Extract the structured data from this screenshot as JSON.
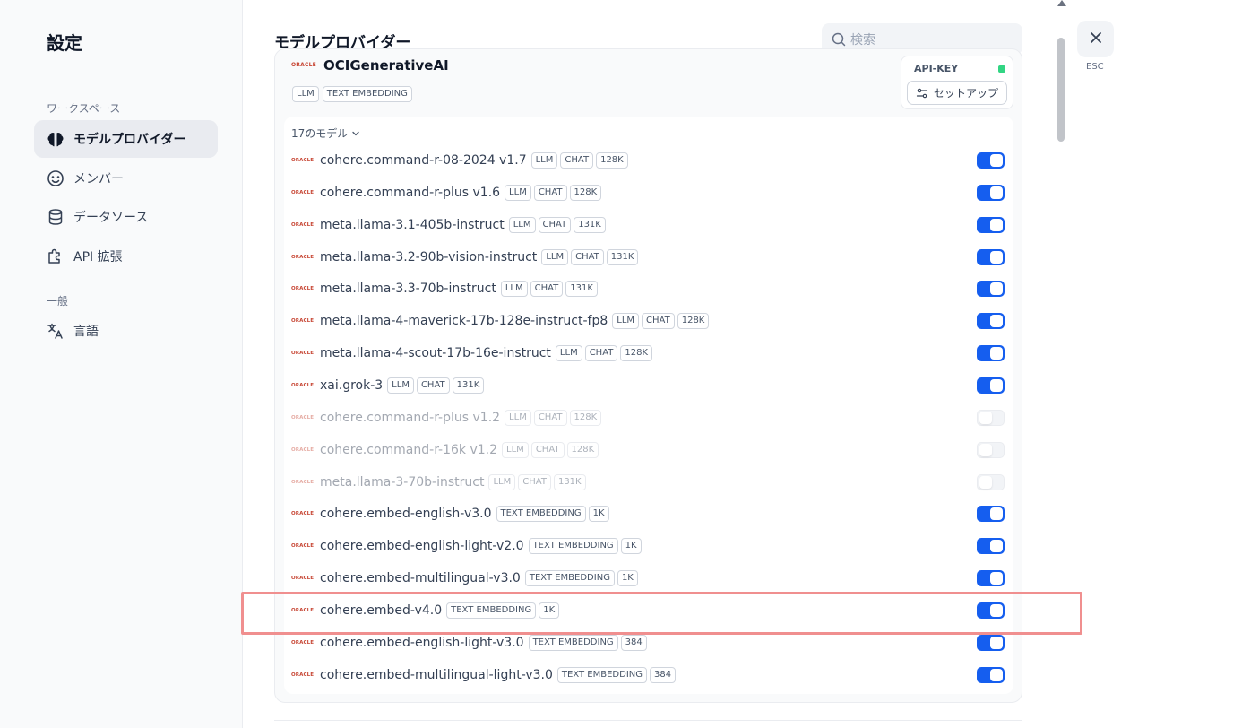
{
  "sidebar": {
    "title": "設定",
    "workspace_label": "ワークスペース",
    "general_label": "一般",
    "items": [
      {
        "label": "モデルプロバイダー"
      },
      {
        "label": "メンバー"
      },
      {
        "label": "データソース"
      },
      {
        "label": "API 拡張"
      },
      {
        "label": "言語"
      }
    ]
  },
  "header": {
    "title": "モデルプロバイダー",
    "search_placeholder": "検索",
    "close_label": "ESC"
  },
  "provider": {
    "logo_text": "ORACLE",
    "name": "OCIGenerativeAI",
    "badges": [
      "LLM",
      "TEXT EMBEDDING"
    ],
    "api_key_label": "API-KEY",
    "api_key_status_color": "#32d583",
    "setup_label": "セットアップ",
    "models_count": "17のモデル"
  },
  "models": [
    {
      "name": "cohere.command-r-08-2024 v1.7",
      "tags": [
        "LLM",
        "CHAT",
        "128K"
      ],
      "enabled": true
    },
    {
      "name": "cohere.command-r-plus v1.6",
      "tags": [
        "LLM",
        "CHAT",
        "128K"
      ],
      "enabled": true
    },
    {
      "name": "meta.llama-3.1-405b-instruct",
      "tags": [
        "LLM",
        "CHAT",
        "131K"
      ],
      "enabled": true
    },
    {
      "name": "meta.llama-3.2-90b-vision-instruct",
      "tags": [
        "LLM",
        "CHAT",
        "131K"
      ],
      "enabled": true
    },
    {
      "name": "meta.llama-3.3-70b-instruct",
      "tags": [
        "LLM",
        "CHAT",
        "131K"
      ],
      "enabled": true
    },
    {
      "name": "meta.llama-4-maverick-17b-128e-instruct-fp8",
      "tags": [
        "LLM",
        "CHAT",
        "128K"
      ],
      "enabled": true
    },
    {
      "name": "meta.llama-4-scout-17b-16e-instruct",
      "tags": [
        "LLM",
        "CHAT",
        "128K"
      ],
      "enabled": true
    },
    {
      "name": "xai.grok-3",
      "tags": [
        "LLM",
        "CHAT",
        "131K"
      ],
      "enabled": true
    },
    {
      "name": "cohere.command-r-plus v1.2",
      "tags": [
        "LLM",
        "CHAT",
        "128K"
      ],
      "enabled": false
    },
    {
      "name": "cohere.command-r-16k v1.2",
      "tags": [
        "LLM",
        "CHAT",
        "128K"
      ],
      "enabled": false
    },
    {
      "name": "meta.llama-3-70b-instruct",
      "tags": [
        "LLM",
        "CHAT",
        "131K"
      ],
      "enabled": false
    },
    {
      "name": "cohere.embed-english-v3.0",
      "tags": [
        "TEXT EMBEDDING",
        "1K"
      ],
      "enabled": true
    },
    {
      "name": "cohere.embed-english-light-v2.0",
      "tags": [
        "TEXT EMBEDDING",
        "1K"
      ],
      "enabled": true
    },
    {
      "name": "cohere.embed-multilingual-v3.0",
      "tags": [
        "TEXT EMBEDDING",
        "1K"
      ],
      "enabled": true
    },
    {
      "name": "cohere.embed-v4.0",
      "tags": [
        "TEXT EMBEDDING",
        "1K"
      ],
      "enabled": true
    },
    {
      "name": "cohere.embed-english-light-v3.0",
      "tags": [
        "TEXT EMBEDDING",
        "384"
      ],
      "enabled": true
    },
    {
      "name": "cohere.embed-multilingual-light-v3.0",
      "tags": [
        "TEXT EMBEDDING",
        "384"
      ],
      "enabled": true
    }
  ],
  "colors": {
    "toggle_on": "#155eef",
    "highlight": "#f08f8f",
    "oracle_red": "#c74634"
  }
}
